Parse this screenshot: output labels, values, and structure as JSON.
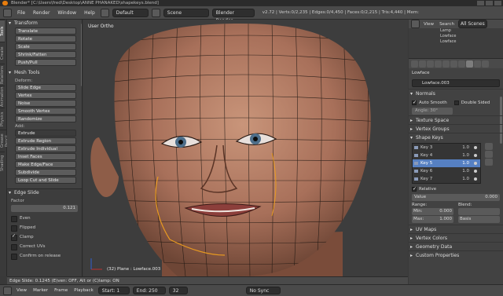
{
  "titlebar": {
    "text": "Blender* [C:\\Users\\fred\\Desktop\\ANNE PHANAKED\\shapekeys.blend]"
  },
  "infobar": {
    "menus": [
      "File",
      "Render",
      "Window",
      "Help"
    ],
    "layout": "Default",
    "scene": "Scene",
    "engine": "Blender Render",
    "stats": "v2.72 | Verts:0/2,235 | Edges:0/4,450 | Faces:0/2,215 | Tris:4,440 | Mem:"
  },
  "vtabs": [
    "Tools",
    "Create",
    "Relations",
    "Animation",
    "Physics",
    "Grease Pencil",
    "Shading"
  ],
  "toolshelf": {
    "transform_header": "Transform",
    "transform_buttons": [
      "Translate",
      "Rotate",
      "Scale",
      "Shrink/Fatten",
      "Push/Pull"
    ],
    "mesh_tools_header": "Mesh Tools",
    "deform_label": "Deform:",
    "deform_buttons": [
      "Slide Edge",
      "Vertex",
      "Noise",
      "Smooth Vertex",
      "Randomize"
    ],
    "add_label": "Add:",
    "add_select": "Extrude",
    "add_buttons": [
      "Extrude Region",
      "Extrude Individual",
      "Inset Faces",
      "Make Edge/Face",
      "Subdivide",
      "Loop Cut and Slide"
    ]
  },
  "redo": {
    "header": "Edge Slide",
    "factor_label": "Factor",
    "factor_value": "0.121",
    "options": [
      {
        "label": "Even",
        "on": false
      },
      {
        "label": "Flipped",
        "on": false
      },
      {
        "label": "Clamp",
        "on": true
      },
      {
        "label": "Correct UVs",
        "on": false
      },
      {
        "label": "Confirm on release",
        "on": false
      }
    ]
  },
  "viewport": {
    "label": "User Ortho",
    "object_label": "(32) Plane : Lowface.003"
  },
  "statusbar": {
    "text": "Edge Slide: 0.1245 (E)ven: OFF, Alt or (C)lamp: ON"
  },
  "timeline": {
    "menus": [
      "View",
      "Marker",
      "Frame",
      "Playback"
    ],
    "start_label": "Start:",
    "start_value": "1",
    "end_label": "End:",
    "end_value": "250",
    "current": "32",
    "sync": "No Sync"
  },
  "outliner": {
    "tabs": [
      "View",
      "Search",
      "All Scenes"
    ],
    "rows": [
      "Lamp",
      "Lowface",
      "Lowface"
    ]
  },
  "properties": {
    "context": "Lowface",
    "mesh_name": "Lowface.003",
    "normals_header": "Normals",
    "auto_smooth": "Auto Smooth",
    "double_sided": "Double Sided",
    "angle": "Angle: 30°",
    "texture_space": "Texture Space",
    "vertex_groups": "Vertex Groups",
    "shape_keys": "Shape Keys",
    "keys": [
      {
        "name": "Key 3",
        "value": "1.0"
      },
      {
        "name": "Key 4",
        "value": "1.0"
      },
      {
        "name": "Key 5",
        "value": "1.0"
      },
      {
        "name": "Key 6",
        "value": "1.0"
      },
      {
        "name": "Key 7",
        "value": "1.0"
      }
    ],
    "relative": "Relative",
    "value_label": "Value",
    "value": "0.000",
    "range_label": "Range:",
    "min_label": "Min:",
    "min_value": "0.000",
    "max_label": "Max:",
    "max_value": "1.000",
    "blend_label": "Blend:",
    "blend_value": "Basis",
    "more_panels": [
      "UV Maps",
      "Vertex Colors",
      "Geometry Data",
      "Custom Properties"
    ]
  },
  "colors": {
    "accent": "#5680c2",
    "orange": "#e87d0d"
  }
}
